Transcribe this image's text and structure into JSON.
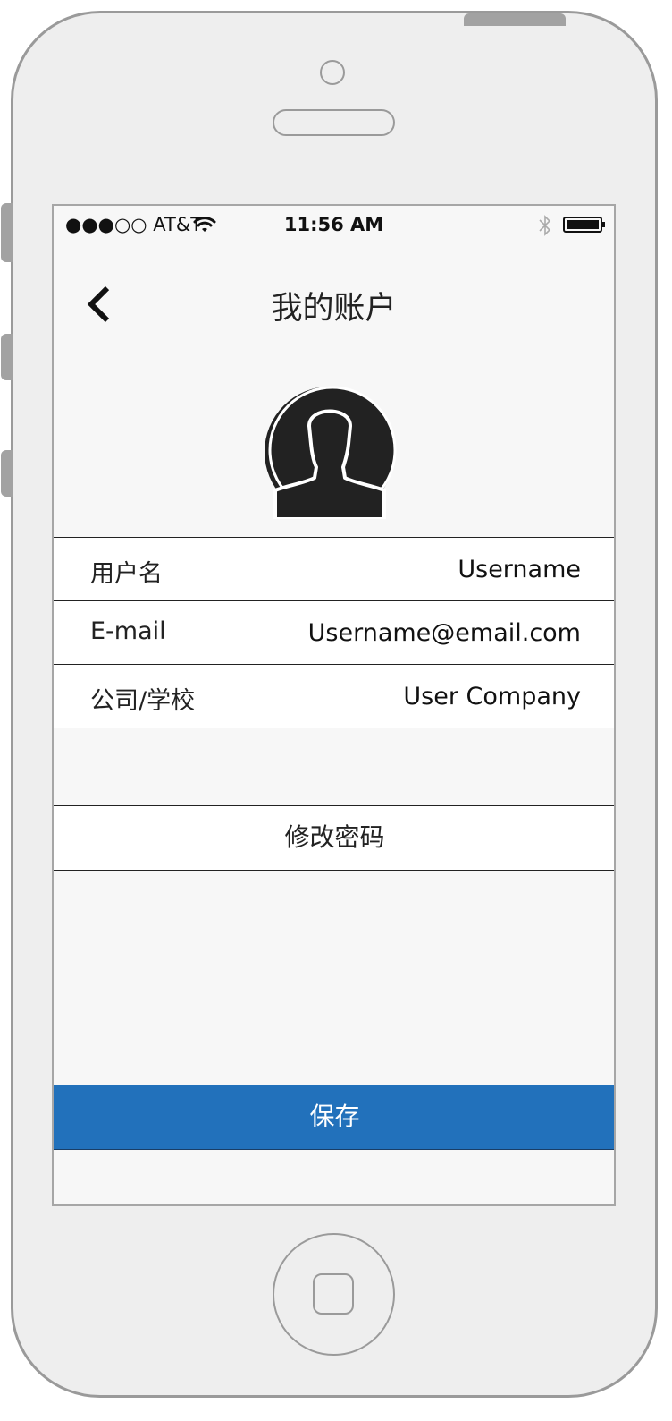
{
  "status_bar": {
    "carrier": "●●●○○ AT&T",
    "time": "11:56 AM"
  },
  "nav": {
    "title": "我的账户"
  },
  "fields": [
    {
      "label": "用户名",
      "value": "Username"
    },
    {
      "label": "E-mail",
      "value": "Username@email.com"
    },
    {
      "label": "公司/学校",
      "value": "User Company"
    }
  ],
  "actions": {
    "change_password": "修改密码",
    "save": "保存"
  },
  "colors": {
    "primary": "#2271bb",
    "screen_bg": "#f7f7f7",
    "frame_bg": "#eeeeee"
  },
  "icons": {
    "back": "chevron-left-icon",
    "avatar": "user-silhouette-icon",
    "wifi": "wifi-icon",
    "bluetooth": "bluetooth-icon",
    "battery": "battery-icon"
  }
}
